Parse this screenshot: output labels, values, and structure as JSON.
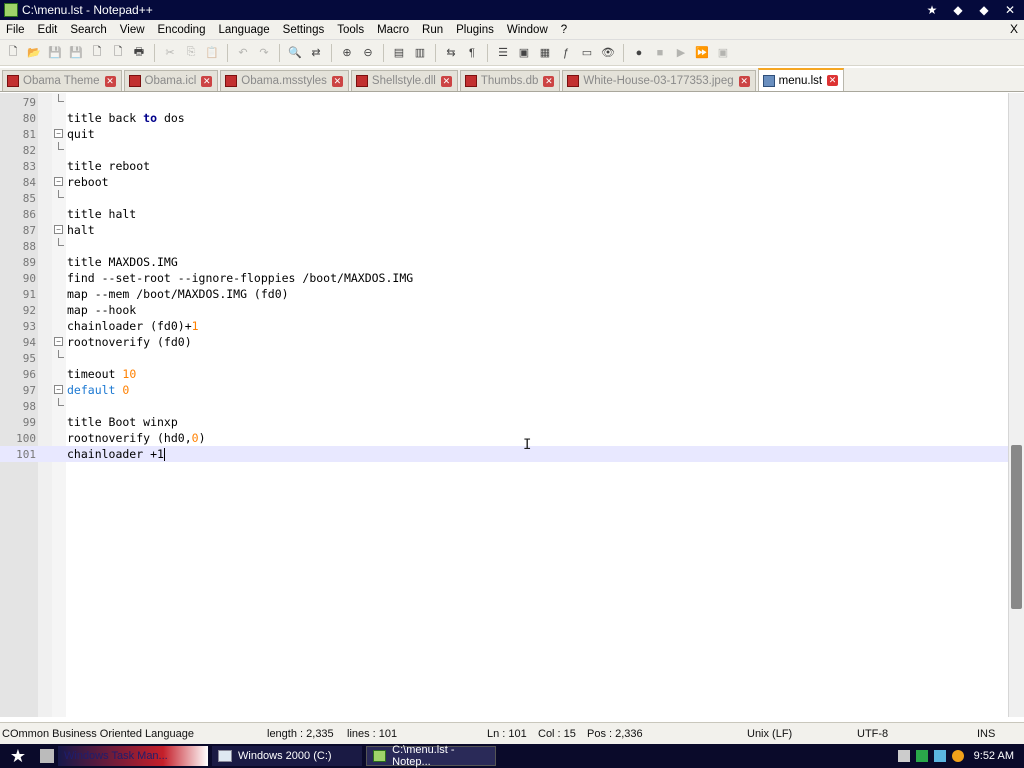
{
  "window": {
    "title": "C:\\menu.lst - Notepad++",
    "close_glyph": "X"
  },
  "menu": [
    "File",
    "Edit",
    "Search",
    "View",
    "Encoding",
    "Language",
    "Settings",
    "Tools",
    "Macro",
    "Run",
    "Plugins",
    "Window",
    "?"
  ],
  "tabs": [
    {
      "label": "Obama Theme",
      "active": false
    },
    {
      "label": "Obama.icl",
      "active": false
    },
    {
      "label": "Obama.msstyles",
      "active": false
    },
    {
      "label": "Shellstyle.dll",
      "active": false
    },
    {
      "label": "Thumbs.db",
      "active": false
    },
    {
      "label": "White-House-03-177353.jpeg",
      "active": false
    },
    {
      "label": "menu.lst",
      "active": true
    }
  ],
  "editor": {
    "lines": [
      {
        "n": "79",
        "fold": "end",
        "code": []
      },
      {
        "n": "80",
        "code": [
          [
            "t",
            "title back "
          ],
          [
            "kw",
            "to"
          ],
          [
            "t",
            " dos"
          ]
        ]
      },
      {
        "n": "81",
        "fold": "box",
        "code": [
          [
            "t",
            "quit"
          ]
        ]
      },
      {
        "n": "82",
        "fold": "end",
        "code": []
      },
      {
        "n": "83",
        "code": [
          [
            "t",
            "title reboot"
          ]
        ]
      },
      {
        "n": "84",
        "fold": "box",
        "code": [
          [
            "t",
            "reboot"
          ]
        ]
      },
      {
        "n": "85",
        "fold": "end",
        "code": []
      },
      {
        "n": "86",
        "code": [
          [
            "t",
            "title halt"
          ]
        ]
      },
      {
        "n": "87",
        "fold": "box",
        "code": [
          [
            "t",
            "halt"
          ]
        ]
      },
      {
        "n": "88",
        "fold": "end",
        "code": []
      },
      {
        "n": "89",
        "code": [
          [
            "t",
            "title MAXDOS.IMG"
          ]
        ]
      },
      {
        "n": "90",
        "code": [
          [
            "t",
            "find --set-root --ignore-floppies /boot/MAXDOS.IMG"
          ]
        ]
      },
      {
        "n": "91",
        "code": [
          [
            "t",
            "map --mem /boot/MAXDOS.IMG (fd0)"
          ]
        ]
      },
      {
        "n": "92",
        "code": [
          [
            "t",
            "map --hook"
          ]
        ]
      },
      {
        "n": "93",
        "code": [
          [
            "t",
            "chainloader (fd0)+"
          ],
          [
            "num",
            "1"
          ]
        ]
      },
      {
        "n": "94",
        "fold": "box",
        "code": [
          [
            "t",
            "rootnoverify (fd0)"
          ]
        ]
      },
      {
        "n": "95",
        "fold": "end",
        "code": []
      },
      {
        "n": "96",
        "code": [
          [
            "t",
            "timeout "
          ],
          [
            "num",
            "10"
          ]
        ]
      },
      {
        "n": "97",
        "fold": "box",
        "code": [
          [
            "blue",
            "default "
          ],
          [
            "num",
            "0"
          ]
        ]
      },
      {
        "n": "98",
        "fold": "end",
        "code": []
      },
      {
        "n": "99",
        "code": [
          [
            "t",
            "title Boot winxp"
          ]
        ]
      },
      {
        "n": "100",
        "code": [
          [
            "t",
            "rootnoverify (hd0,"
          ],
          [
            "num",
            "0"
          ],
          [
            "t",
            ")"
          ]
        ]
      },
      {
        "n": "101",
        "current": true,
        "caret": true,
        "code": [
          [
            "t",
            "chainloader +1"
          ]
        ]
      }
    ]
  },
  "status": {
    "lang": "COmmon Business Oriented Language",
    "length": "length : 2,335",
    "lines": "lines : 101",
    "ln": "Ln : 101",
    "col": "Col : 15",
    "pos": "Pos : 2,336",
    "eol": "Unix (LF)",
    "enc": "UTF-8",
    "mode": "INS"
  },
  "taskbar": {
    "tasks": [
      "Windows Task Man...",
      "Windows 2000 (C:)",
      "C:\\menu.lst - Notep..."
    ],
    "clock": "9:52 AM"
  }
}
